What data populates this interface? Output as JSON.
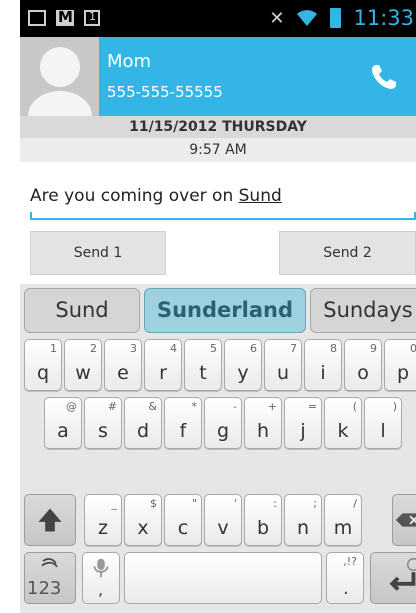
{
  "status_bar": {
    "time": "11:33",
    "icons": [
      "voicemail-icon",
      "gmail-icon",
      "calendar-icon",
      "mute-icon",
      "wifi-icon",
      "battery-icon"
    ]
  },
  "contact": {
    "name": "Mom",
    "number": "555-555-55555",
    "avatar": "avatar-placeholder-icon",
    "call_icon": "phone-icon"
  },
  "conversation": {
    "date": "11/15/2012 THURSDAY",
    "time": "9:57 AM"
  },
  "compose": {
    "text_before": "Are you coming over on ",
    "current_word": "Sund"
  },
  "actions": {
    "send1": "Send 1",
    "send2": "Send 2"
  },
  "keyboard": {
    "suggestions": [
      "Sund",
      "Sunderland",
      "Sundays"
    ],
    "row1": [
      {
        "key": "q",
        "hint": "1"
      },
      {
        "key": "w",
        "hint": "2"
      },
      {
        "key": "e",
        "hint": "3"
      },
      {
        "key": "r",
        "hint": "4"
      },
      {
        "key": "t",
        "hint": "5"
      },
      {
        "key": "y",
        "hint": "6"
      },
      {
        "key": "u",
        "hint": "7"
      },
      {
        "key": "i",
        "hint": "8"
      },
      {
        "key": "o",
        "hint": "9"
      },
      {
        "key": "p",
        "hint": "0"
      }
    ],
    "row2": [
      {
        "key": "a",
        "hint": "@"
      },
      {
        "key": "s",
        "hint": "#"
      },
      {
        "key": "d",
        "hint": "&"
      },
      {
        "key": "f",
        "hint": "*"
      },
      {
        "key": "g",
        "hint": "-"
      },
      {
        "key": "h",
        "hint": "+"
      },
      {
        "key": "j",
        "hint": "="
      },
      {
        "key": "k",
        "hint": "("
      },
      {
        "key": "l",
        "hint": ")"
      }
    ],
    "row3": [
      {
        "key": "z",
        "hint": "_"
      },
      {
        "key": "x",
        "hint": "$"
      },
      {
        "key": "c",
        "hint": "\""
      },
      {
        "key": "v",
        "hint": "'"
      },
      {
        "key": "b",
        "hint": ":"
      },
      {
        "key": "n",
        "hint": ";"
      },
      {
        "key": "m",
        "hint": "/"
      }
    ],
    "num_label": "123",
    "comma": ",",
    "period": ".",
    "period_hint": ",!?"
  },
  "colors": {
    "accent": "#33b5e5",
    "suggestion_selected": "#9fd0e0"
  }
}
